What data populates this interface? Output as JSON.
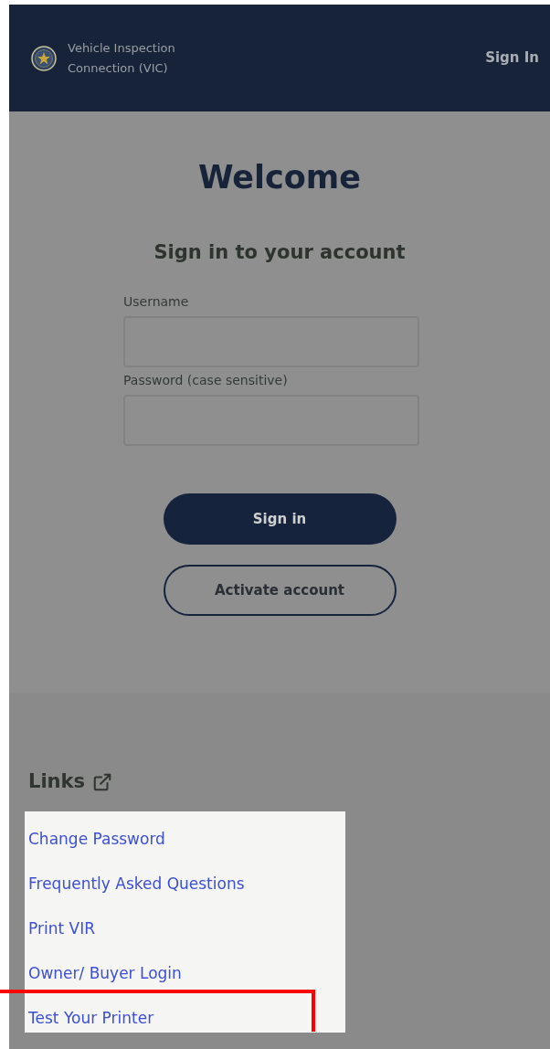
{
  "header": {
    "title": "Vehicle Inspection Connection (VIC)",
    "sign_in": "Sign In"
  },
  "welcome": "Welcome",
  "subtitle": "Sign in to your account",
  "fields": [
    {
      "label": "Username"
    },
    {
      "label": "Password (case sensitive)"
    }
  ],
  "buttons": [
    {
      "label": "Sign in",
      "kind": "primary"
    },
    {
      "label": "Activate account",
      "kind": "outline"
    }
  ],
  "links": {
    "heading": "Links",
    "items": [
      {
        "label": "Change Password",
        "highlighted": false
      },
      {
        "label": "Frequently Asked Questions",
        "highlighted": false
      },
      {
        "label": "Print VIR",
        "highlighted": false
      },
      {
        "label": "Owner/ Buyer Login",
        "highlighted": false
      },
      {
        "label": "Test Your Printer",
        "highlighted": true
      }
    ]
  }
}
